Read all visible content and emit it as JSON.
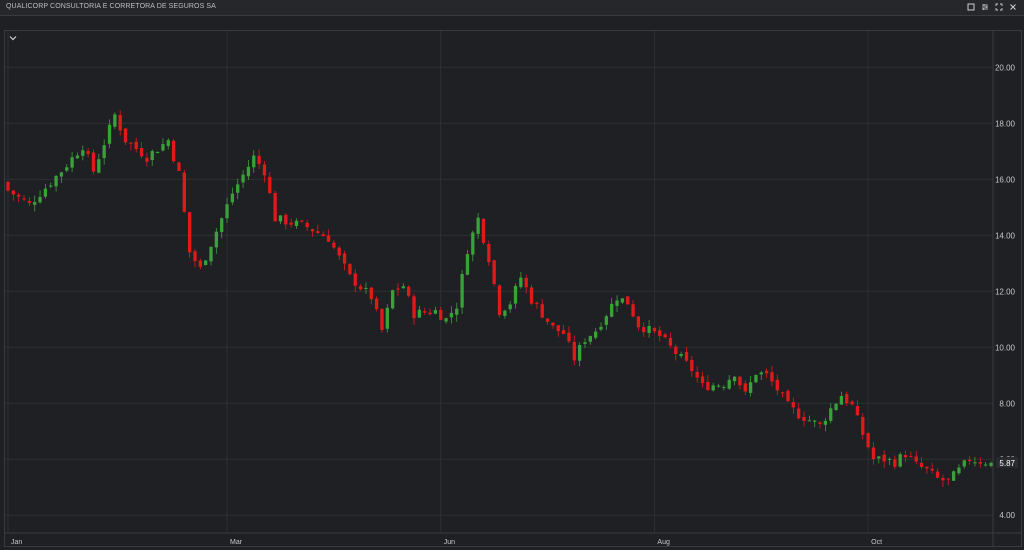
{
  "window": {
    "title": "QUALICORP CONSULTORIA E CORRETORA DE SEGUROS SA",
    "controls": [
      {
        "name": "maximize-icon"
      },
      {
        "name": "settings-sliders-icon"
      },
      {
        "name": "fullscreen-icon"
      },
      {
        "name": "close-icon"
      }
    ]
  },
  "colors": {
    "background": "#1f2023",
    "grid": "#2e2f33",
    "up": "#3aa03a",
    "down": "#e01a1a",
    "axis_text": "#c8c8c8",
    "price_label_bg": "#2a2b2e"
  },
  "chart_data": {
    "type": "candlestick",
    "title": "",
    "xlabel": "",
    "ylabel": "",
    "y_axis_position": "right",
    "ylim": [
      3.4,
      21.3
    ],
    "y_ticks": [
      "4.00",
      "6.00",
      "8.00",
      "10.00",
      "12.00",
      "14.00",
      "16.00",
      "18.00",
      "20.00"
    ],
    "x_ticks": [
      {
        "label": "Jan",
        "index": 0
      },
      {
        "label": "Mar",
        "index": 41
      },
      {
        "label": "Jun",
        "index": 81
      },
      {
        "label": "Aug",
        "index": 121
      },
      {
        "label": "Oct",
        "index": 161
      }
    ],
    "grid": true,
    "last_price": "5.87",
    "candles": []
  }
}
